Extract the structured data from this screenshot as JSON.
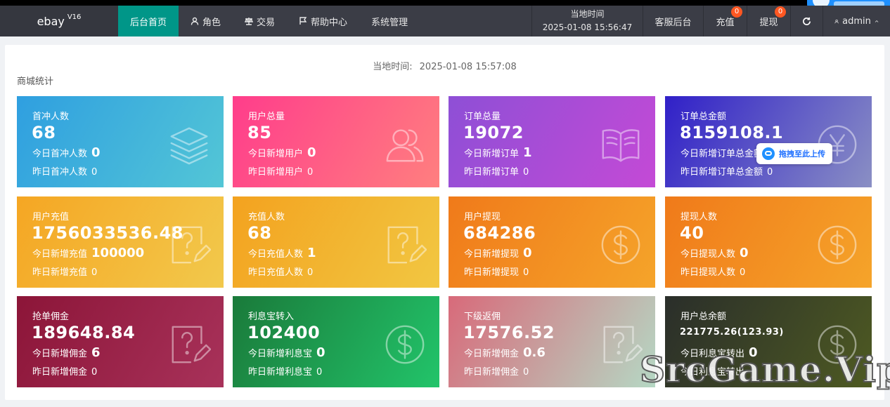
{
  "topnav": {
    "brand": "ebay",
    "brand_version": "V16",
    "items": [
      {
        "label": "后台首页",
        "active": true
      },
      {
        "label": "角色",
        "icon": "user-icon"
      },
      {
        "label": "交易",
        "icon": "scale-icon"
      },
      {
        "label": "帮助中心",
        "icon": "flag-icon"
      },
      {
        "label": "系统管理"
      }
    ],
    "time_label": "当地时间",
    "time_value": "2025-01-08 15:56:47",
    "service": "客服后台",
    "recharge": "充值",
    "recharge_badge": "0",
    "withdraw": "提现",
    "withdraw_badge": "0",
    "user": "admin"
  },
  "panel": {
    "local_time_label": "当地时间:",
    "local_time_value": "2025-01-08 15:57:08",
    "section_title": "商城统计"
  },
  "cards": [
    {
      "title": "首冲人数",
      "value": "68",
      "today_label": "今日首冲人数",
      "today_value": "0",
      "yest_label": "昨日首冲人数",
      "yest_value": "0",
      "icon": "layers-icon",
      "gradient": [
        "#2f9fe0",
        "#53c6d6"
      ]
    },
    {
      "title": "用户总量",
      "value": "85",
      "today_label": "今日新增用户",
      "today_value": "0",
      "yest_label": "昨日新增用户",
      "yest_value": "0",
      "icon": "users-icon",
      "gradient": [
        "#ff3d8b",
        "#ff7f7f"
      ]
    },
    {
      "title": "订单总量",
      "value": "19072",
      "today_label": "今日新增订单",
      "today_value": "1",
      "yest_label": "昨日新增订单",
      "yest_value": "0",
      "icon": "book-icon",
      "gradient": [
        "#8e4fd6",
        "#c44ad6"
      ]
    },
    {
      "title": "订单总金额",
      "value": "8159108.1",
      "today_label": "今日新增订单总金额",
      "today_value": "",
      "yest_label": "昨日新增订单总金额",
      "yest_value": "0",
      "icon": "yen-icon",
      "gradient": [
        "#3020c8",
        "#8a8fc4"
      ]
    },
    {
      "title": "用户充值",
      "value": "1756033536.48",
      "today_label": "今日新增充值",
      "today_value": "100000",
      "yest_label": "昨日新增充值",
      "yest_value": "0",
      "icon": "question-edit-icon",
      "gradient": [
        "#f5a623",
        "#f2c94c"
      ]
    },
    {
      "title": "充值人数",
      "value": "68",
      "today_label": "今日充值人数",
      "today_value": "1",
      "yest_label": "昨日充值人数",
      "yest_value": "0",
      "icon": "question-edit-icon",
      "gradient": [
        "#f3a21f",
        "#f2c742"
      ]
    },
    {
      "title": "用户提现",
      "value": "684286",
      "today_label": "今日新增提现",
      "today_value": "0",
      "yest_label": "昨日新增提现",
      "yest_value": "0",
      "icon": "dollar-icon",
      "gradient": [
        "#f07a1a",
        "#f5a42a"
      ]
    },
    {
      "title": "提现人数",
      "value": "40",
      "today_label": "今日提现人数",
      "today_value": "0",
      "yest_label": "昨日提现人数",
      "yest_value": "0",
      "icon": "dollar-icon",
      "gradient": [
        "#f07a1a",
        "#f5a42a"
      ]
    },
    {
      "title": "抢单佣金",
      "value": "189648.84",
      "today_label": "今日新增佣金",
      "today_value": "6",
      "yest_label": "昨日新增佣金",
      "yest_value": "0",
      "icon": "question-edit-icon",
      "gradient": [
        "#8c1538",
        "#a8325a"
      ]
    },
    {
      "title": "利息宝转入",
      "value": "102400",
      "today_label": "今日新增利息宝",
      "today_value": "0",
      "yest_label": "昨日新增利息宝",
      "yest_value": "0",
      "icon": "dollar-icon",
      "gradient": [
        "#1a7a3a",
        "#22c46a"
      ]
    },
    {
      "title": "下级返佣",
      "value": "17576.52",
      "today_label": "今日新增佣金",
      "today_value": "0.6",
      "yest_label": "昨日新增佣金",
      "yest_value": "0",
      "icon": "question-edit-icon",
      "gradient": [
        "#d86a7a",
        "#b5d8c4"
      ]
    },
    {
      "title": "用户总余额",
      "value": "221775.26(123.93)",
      "today_label": "今日利息宝转出",
      "today_value": "0",
      "yest_label": "今日利息宝转出",
      "yest_value": "",
      "icon": "dollar-icon",
      "gradient": [
        "#2a2e2a",
        "#4e5a22"
      ]
    }
  ],
  "upload_tip": "拖拽至此上传",
  "watermark": "SrcGame.Vip"
}
